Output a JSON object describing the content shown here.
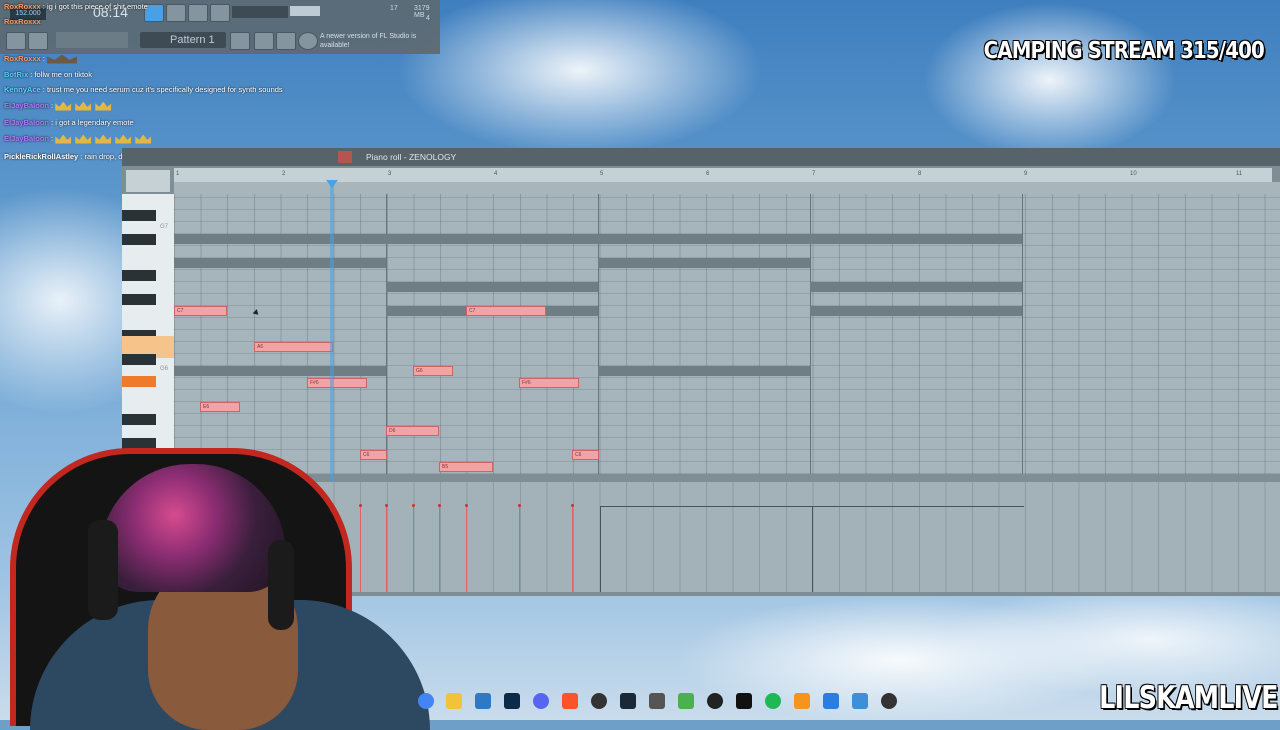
{
  "overlay": {
    "stream_title": "CAMPING STREAM 315/400",
    "streamer_name": "LILSKAMLIVE"
  },
  "fl_toolbar": {
    "clock": "08:14",
    "bpm": "152.000",
    "pattern_label": "Pattern 1",
    "cpu_value": "17",
    "ram_value": "3179 MB",
    "poly_value": "4",
    "news_text": "A newer version of FL Studio is available!"
  },
  "chat": [
    {
      "user": "RoxRoxxx",
      "text": "ig i got this piece of shit emote",
      "color": "#ff9966"
    },
    {
      "user": "RoxRoxxx",
      "text": "",
      "color": "#ff9966"
    },
    {
      "user": "BotRix",
      "text": "follw me on tiktok",
      "color": "#5ad1ff"
    },
    {
      "user": "KennyAce",
      "text": "trust me you need serum cuz it's specifically designed for synth sounds",
      "color": "#5ad1ff"
    },
    {
      "user": "ElJayBaloon",
      "text": "",
      "color": "#b27cff"
    },
    {
      "user": "ElJayBaloon",
      "text": "i got a legendary emote",
      "color": "#b27cff"
    },
    {
      "user": "ElJayBaloon",
      "text": "",
      "color": "#b27cff"
    },
    {
      "user": "PickleRickRollAstley",
      "text": "rain drop, drop top, the streamer loves getting slapped with my fat cock",
      "color": "#ffffff"
    }
  ],
  "piano_roll": {
    "title": "Piano roll - ZENOLOGY",
    "bar_numbers": [
      "1",
      "2",
      "3",
      "4",
      "5",
      "6",
      "7",
      "8",
      "9",
      "10",
      "11"
    ],
    "octave_labels": [
      "G7",
      "G6"
    ],
    "notes": [
      {
        "label": "C7"
      },
      {
        "label": "A6"
      },
      {
        "label": "F#6"
      },
      {
        "label": "E6"
      },
      {
        "label": "G6"
      },
      {
        "label": "D6"
      },
      {
        "label": "C6"
      },
      {
        "label": "B5"
      },
      {
        "label": "C7"
      },
      {
        "label": "F#6"
      },
      {
        "label": "C6"
      }
    ]
  },
  "taskbar": {
    "icons": [
      "chrome-icon",
      "folder-icon",
      "store-icon",
      "photoshop-icon",
      "discord-icon",
      "brave-icon",
      "obs-icon",
      "steam-icon",
      "app-icon",
      "game-icon",
      "4k-icon",
      "capcut-icon",
      "spotify-icon",
      "fl-studio-icon",
      "azure-icon",
      "notepad-icon",
      "media-icon"
    ]
  },
  "colors": {
    "note_fill": "#f2a3a3",
    "ghost_note": "#6f7d84",
    "playhead": "#4aa3e8",
    "grid_bg": "#a6b5bc"
  }
}
